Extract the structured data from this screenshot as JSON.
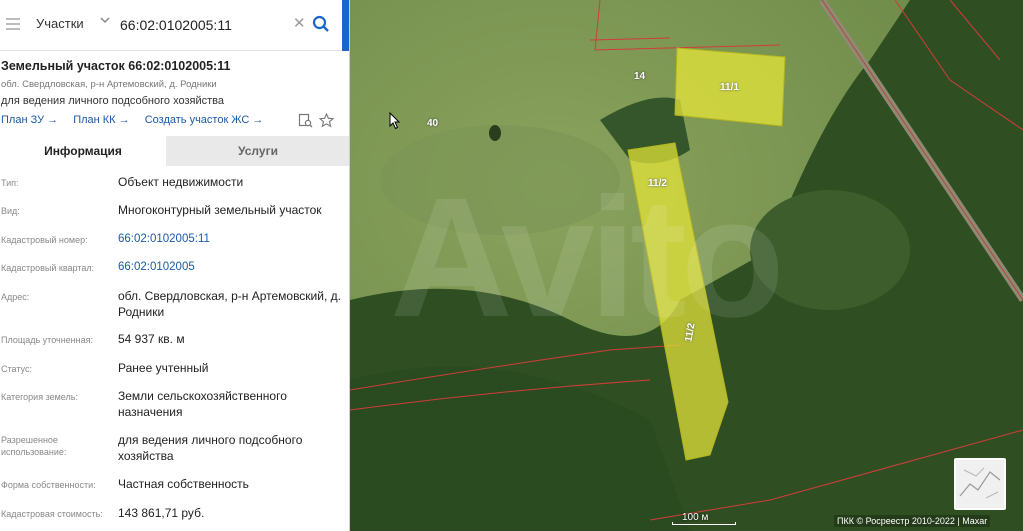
{
  "search": {
    "layer": "Участки",
    "query": "66:02:0102005:11"
  },
  "parcel": {
    "title": "Земельный участок 66:02:0102005:11",
    "address_short": "обл. Свердловская, р-н Артемовский, д. Родники",
    "purpose": "для ведения личного подсобного хозяйства"
  },
  "links": {
    "plan_zu": "План ЗУ →",
    "plan_kk": "План КК →",
    "create_zhs": "Создать участок ЖС →"
  },
  "tabs": {
    "info": "Информация",
    "services": "Услуги"
  },
  "rows": [
    {
      "label": "Тип:",
      "value": "Объект недвижимости"
    },
    {
      "label": "Вид:",
      "value": "Многоконтурный земельный участок"
    },
    {
      "label": "Кадастровый номер:",
      "value": "66:02:0102005:11"
    },
    {
      "label": "Кадастровый квартал:",
      "value": "66:02:0102005"
    },
    {
      "label": "Адрес:",
      "value": "обл. Свердловская, р-н Артемовский, д. Родники"
    },
    {
      "label": "Площадь уточненная:",
      "value": "54 937 кв. м"
    },
    {
      "label": "Статус:",
      "value": "Ранее учтенный"
    },
    {
      "label": "Категория земель:",
      "value": "Земли сельскохозяйственного назначения"
    },
    {
      "label": "Разрешенное использование:",
      "value": "для ведения личного подсобного хозяйства"
    },
    {
      "label": "Форма собственности:",
      "value": "Частная собственность"
    },
    {
      "label": "Кадастровая стоимость:",
      "value": "143 861,71 руб."
    }
  ],
  "map": {
    "parcel_labels": [
      "11/1",
      "11/2",
      "11/2"
    ],
    "ref_labels": [
      "14",
      "40"
    ],
    "watermark": "Avito",
    "scale": "100 м",
    "attribution": "ПКК © Росреестр 2010-2022 | Maxar"
  },
  "colors": {
    "accent": "#1a66c8",
    "link": "#1a5aa8",
    "parcel_fill": "#e6e639",
    "boundary": "#d23c3c"
  }
}
